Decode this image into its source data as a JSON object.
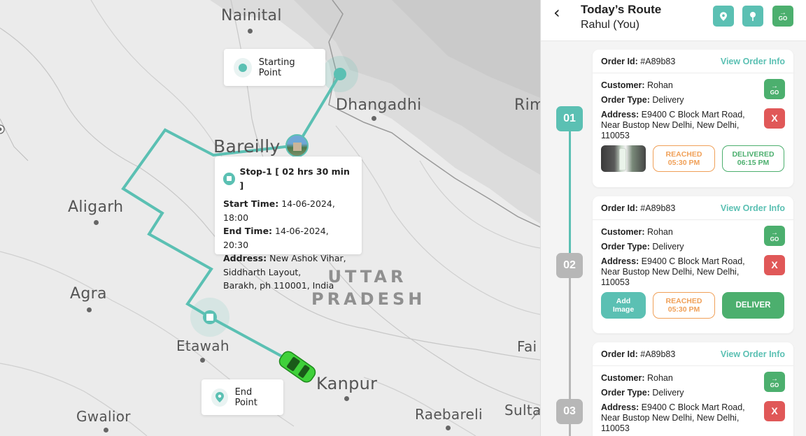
{
  "map": {
    "cities": [
      {
        "name": "Nainital"
      },
      {
        "name": "Dhangadhi"
      },
      {
        "name": "Rim"
      },
      {
        "name": "Bareilly"
      },
      {
        "name": "Aligarh"
      },
      {
        "name": "Agra"
      },
      {
        "name": "Etawah"
      },
      {
        "name": "Kanpur"
      },
      {
        "name": "Gwalior"
      },
      {
        "name": "Raebareli"
      },
      {
        "name": "Sulta"
      },
      {
        "name": "Fai"
      }
    ],
    "state_label": {
      "line1": "UTTAR",
      "line2": "PRADESH"
    },
    "starting_point_label": "Starting Point",
    "end_point_label": "End Point",
    "stop_popup": {
      "title": "Stop-1 [ 02 hrs 30 min ]",
      "start_label": "Start Time:",
      "start_value": "14-06-2024, 18:00",
      "end_label": "End Time:",
      "end_value": "14-06-2024, 20:30",
      "address_label": "Address:",
      "address_line1": "New Ashok Vihar,",
      "address_line2": "Siddharth Layout,",
      "address_line3": "Barakh, ph 110001, India"
    },
    "route_color": "#5bc0b3",
    "vehicle_color": "#3fd13a"
  },
  "panel": {
    "title": "Today’s Route",
    "subtitle": "Rahul (You)",
    "header_buttons": [
      {
        "icon": "location-pin-icon"
      },
      {
        "icon": "map-marker-icon"
      },
      {
        "icon": "go-arrow-icon",
        "label": "GO"
      }
    ],
    "orders": [
      {
        "step": "01",
        "order_id_label": "Order Id:",
        "order_id": "#A89b83",
        "view_label": "View Order Info",
        "customer_label": "Customer:",
        "customer": "Rohan",
        "type_label": "Order Type:",
        "type": "Delivery",
        "address_label": "Address:",
        "address": "E9400 C Block Mart Road, Near Bustop New Delhi, New Delhi, 110053",
        "go_label": "GO",
        "cancel_label": "X",
        "reached_label": "REACHED",
        "reached_time": "05:30 PM",
        "delivered_label": "DELIVERED",
        "delivered_time": "06:15 PM"
      },
      {
        "step": "02",
        "order_id_label": "Order Id:",
        "order_id": "#A89b83",
        "view_label": "View Order Info",
        "customer_label": "Customer:",
        "customer": "Rohan",
        "type_label": "Order Type:",
        "type": "Delivery",
        "address_label": "Address:",
        "address": "E9400 C Block Mart Road, Near Bustop New Delhi, New Delhi, 110053",
        "go_label": "GO",
        "cancel_label": "X",
        "add_image_line1": "Add",
        "add_image_line2": "Image",
        "reached_label": "REACHED",
        "reached_time": "05:30 PM",
        "deliver_label": "DELIVER"
      },
      {
        "step": "03",
        "order_id_label": "Order Id:",
        "order_id": "#A89b83",
        "view_label": "View Order Info",
        "customer_label": "Customer:",
        "customer": "Rohan",
        "type_label": "Order Type:",
        "type": "Delivery",
        "address_label": "Address:",
        "address": "E9400 C Block Mart Road, Near Bustop New Delhi, New Delhi, 110053",
        "go_label": "GO",
        "cancel_label": "X"
      }
    ],
    "colors": {
      "teal": "#5bc0b3",
      "green": "#4caf6e",
      "red": "#e05858",
      "orange": "#f0a058",
      "grey": "#b7b7b7"
    }
  }
}
